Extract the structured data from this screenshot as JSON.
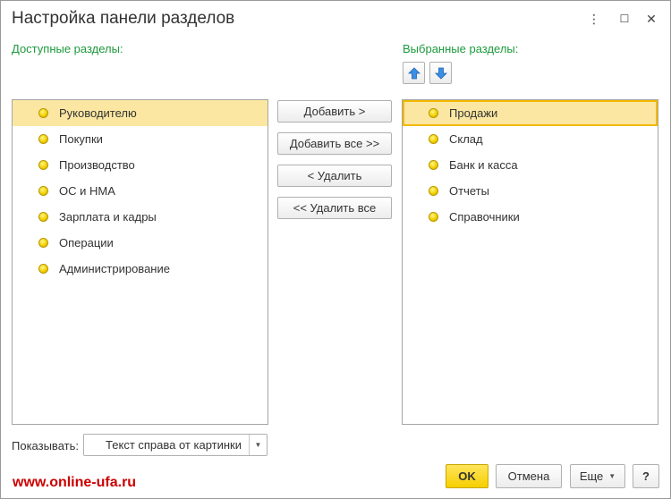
{
  "window": {
    "title": "Настройка панели разделов",
    "menu_glyph": "⋮",
    "maximize_glyph": "☐",
    "close_glyph": "✕"
  },
  "available": {
    "label": "Доступные разделы:",
    "items": [
      {
        "label": "Руководителю",
        "selected": true
      },
      {
        "label": "Покупки"
      },
      {
        "label": "Производство"
      },
      {
        "label": "ОС и НМА"
      },
      {
        "label": "Зарплата и кадры"
      },
      {
        "label": "Операции"
      },
      {
        "label": "Администрирование"
      }
    ]
  },
  "selected": {
    "label": "Выбранные разделы:",
    "items": [
      {
        "label": "Продажи",
        "selected": true
      },
      {
        "label": "Склад"
      },
      {
        "label": "Банк и касса"
      },
      {
        "label": "Отчеты"
      },
      {
        "label": "Справочники"
      }
    ]
  },
  "actions": {
    "add": "Добавить >",
    "add_all": "Добавить все >>",
    "remove": "< Удалить",
    "remove_all": "<< Удалить все"
  },
  "display": {
    "label": "Показывать:",
    "value": "Текст справа от картинки"
  },
  "footer": {
    "ok": "OK",
    "cancel": "Отмена",
    "more": "Еще",
    "help": "?",
    "watermark": "www.online-ufa.ru"
  },
  "colors": {
    "accent_green": "#1c9a3c",
    "selection": "#fbe7a1",
    "ok_yellow": "#f6cf00",
    "watermark_red": "#cc0000"
  }
}
